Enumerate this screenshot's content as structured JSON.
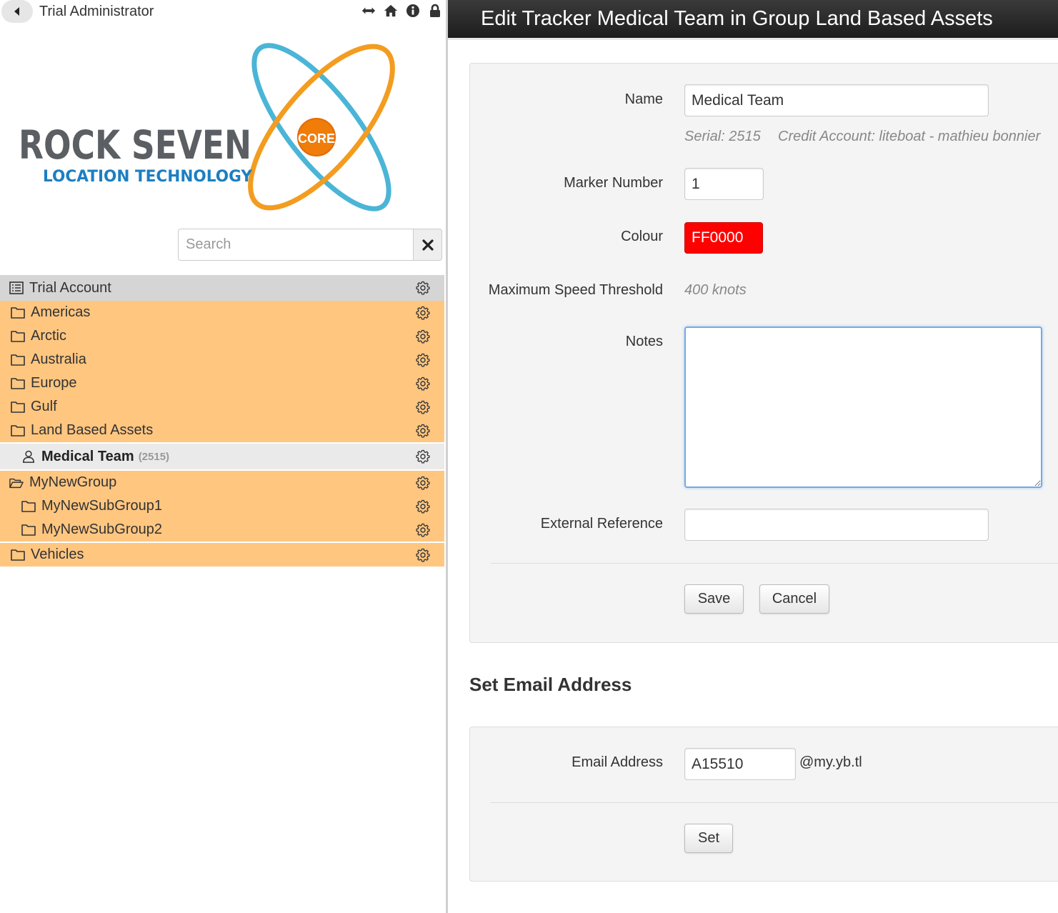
{
  "sidebar": {
    "user_name": "Trial Administrator",
    "logo": {
      "brand": "ROCK SEVEN",
      "tagline": "LOCATION TECHNOLOGY",
      "badge": "CORE"
    },
    "search_placeholder": "Search",
    "tree": {
      "account": "Trial Account",
      "groups_top": [
        "Americas",
        "Arctic",
        "Australia",
        "Europe",
        "Gulf",
        "Land Based Assets"
      ],
      "selected_tracker": {
        "label": "Medical Team",
        "serial": "(2515)"
      },
      "open_group": "MyNewGroup",
      "subgroups": [
        "MyNewSubGroup1",
        "MyNewSubGroup2"
      ],
      "last_group": "Vehicles"
    }
  },
  "header": {
    "title": "Edit Tracker Medical Team in Group Land Based Assets"
  },
  "form": {
    "name_label": "Name",
    "name_value": "Medical Team",
    "serial_text": "Serial: 2515",
    "credit_text": "Credit Account: liteboat - mathieu bonnier",
    "marker_label": "Marker Number",
    "marker_value": "1",
    "colour_label": "Colour",
    "colour_value": "FF0000",
    "speed_label": "Maximum Speed Threshold",
    "speed_value": "400 knots",
    "notes_label": "Notes",
    "notes_value": "",
    "extref_label": "External Reference",
    "extref_value": "",
    "save_label": "Save",
    "cancel_label": "Cancel"
  },
  "email": {
    "section_title": "Set Email Address",
    "label": "Email Address",
    "value": "A15510",
    "domain": "@my.yb.tl",
    "set_label": "Set"
  },
  "colors": {
    "group_row": "#ffc680",
    "account_row": "#d5d5d5",
    "tracker_row": "#eaeaea",
    "header_bg": "#222222",
    "colour_swatch": "#ff0000"
  }
}
